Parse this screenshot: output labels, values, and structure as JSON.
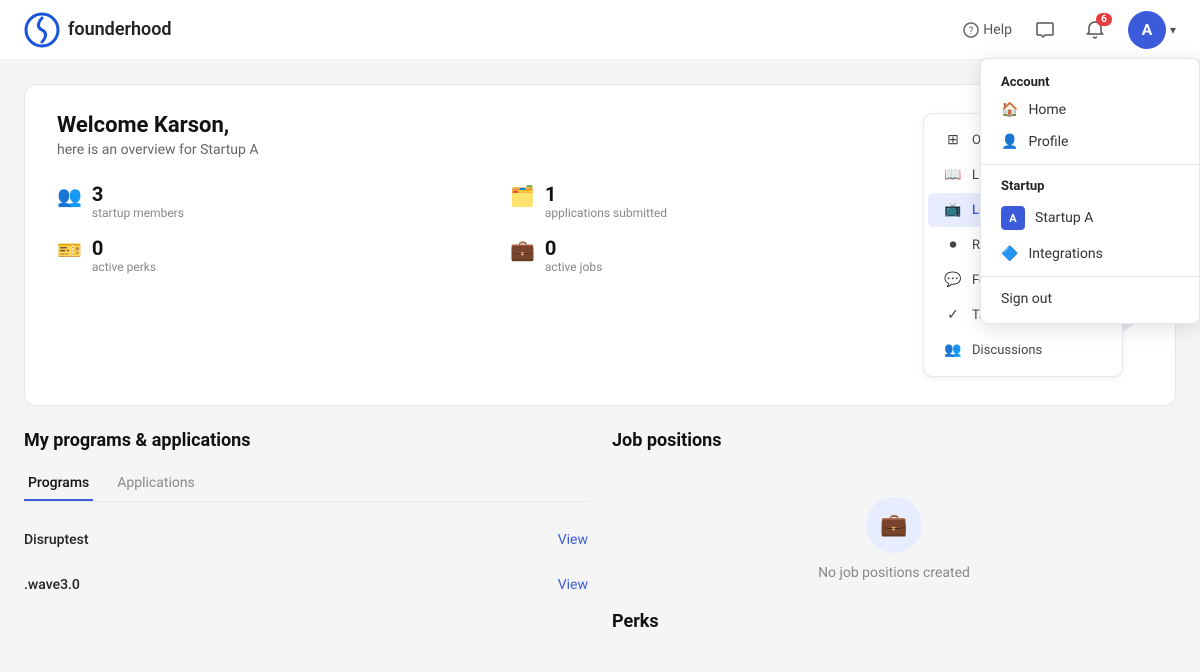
{
  "header": {
    "logo_text": "founderhood",
    "help_label": "Help",
    "notif_count": "6",
    "avatar_letter": "A"
  },
  "dropdown": {
    "account_section": "Account",
    "home_label": "Home",
    "profile_label": "Profile",
    "startup_section": "Startup",
    "startup_name": "Startup A",
    "startup_letter": "A",
    "integrations_label": "Integrations",
    "signout_label": "Sign out"
  },
  "welcome": {
    "title": "Welcome Karson,",
    "subtitle": "here is an overview for Startup A",
    "stats": [
      {
        "number": "3",
        "label": "startup members"
      },
      {
        "number": "1",
        "label": "applications submitted"
      },
      {
        "number": "0",
        "label": "active perks"
      },
      {
        "number": "0",
        "label": "active jobs"
      }
    ]
  },
  "nav": {
    "items": [
      {
        "label": "Overview",
        "icon": "⊞"
      },
      {
        "label": "Library",
        "icon": "📖"
      },
      {
        "label": "Live",
        "icon": "📺",
        "active": true
      },
      {
        "label": "Recordings",
        "icon": "⏺"
      },
      {
        "label": "Forum",
        "icon": "💬"
      },
      {
        "label": "Tasks",
        "icon": "✓"
      },
      {
        "label": "Discussions",
        "icon": "👥"
      }
    ]
  },
  "programs_section": {
    "title": "My programs & applications",
    "tab_programs": "Programs",
    "tab_applications": "Applications",
    "programs": [
      {
        "name": "Disruptest",
        "link": "View"
      },
      {
        "name": ".wave3.0",
        "link": "View"
      }
    ]
  },
  "job_positions": {
    "title": "Job positions",
    "empty_text": "No job positions created"
  },
  "perks": {
    "title": "Perks"
  }
}
